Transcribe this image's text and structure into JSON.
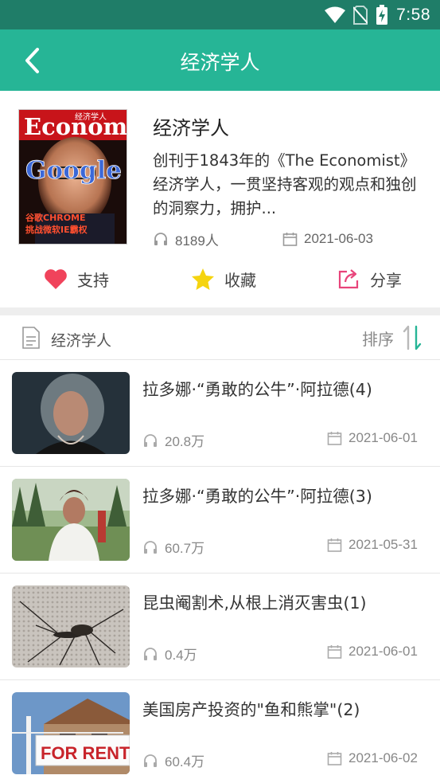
{
  "status": {
    "time": "7:58"
  },
  "header": {
    "title": "经济学人"
  },
  "album": {
    "title": "经济学人",
    "description": "创刊于1843年的《The Economist》经济学人，一贯坚持客观的观点和独创的洞察力，拥护...",
    "listeners": "8189人",
    "date": "2021-06-03",
    "cover": {
      "masthead": "Economist",
      "top_text": "经济学人",
      "headline": "Google",
      "line1": "谷歌CHROME",
      "line2": "挑战微软IE霸权"
    }
  },
  "actions": {
    "support": "支持",
    "favorite": "收藏",
    "share": "分享"
  },
  "list": {
    "title": "经济学人",
    "sort_label": "排序",
    "items": [
      {
        "title": "拉多娜·“勇敢的公牛”·阿拉德(4)",
        "plays": "20.8万",
        "date": "2021-06-01"
      },
      {
        "title": "拉多娜·“勇敢的公牛”·阿拉德(3)",
        "plays": "60.7万",
        "date": "2021-05-31"
      },
      {
        "title": "昆虫阉割术,从根上消灭害虫(1)",
        "plays": "0.4万",
        "date": "2021-06-01"
      },
      {
        "title": "美国房产投资的\"鱼和熊掌\"(2)",
        "plays": "60.4万",
        "date": "2021-06-02",
        "thumb_sign": "FOR RENT"
      }
    ]
  },
  "colors": {
    "status_bar": "#1f7d68",
    "app_bar": "#26b596",
    "heart": "#f0435b",
    "star": "#f5d40f",
    "share": "#e8447a",
    "sort_accent": "#26b596"
  }
}
